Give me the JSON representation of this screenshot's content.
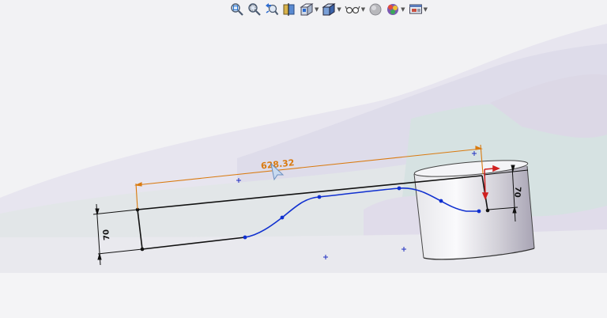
{
  "toolbar": {
    "items": [
      {
        "icon": "zoom-to-fit-icon",
        "has_dropdown": false
      },
      {
        "icon": "zoom-to-area-icon",
        "has_dropdown": false
      },
      {
        "icon": "previous-view-icon",
        "has_dropdown": false
      },
      {
        "icon": "section-view-icon",
        "has_dropdown": false
      },
      {
        "icon": "view-orientation-icon",
        "has_dropdown": true
      },
      {
        "icon": "display-style-icon",
        "has_dropdown": true
      },
      {
        "icon": "hide-show-items-icon",
        "has_dropdown": true
      },
      {
        "icon": "edit-appearance-icon",
        "has_dropdown": false
      },
      {
        "icon": "apply-scene-icon",
        "has_dropdown": true
      },
      {
        "icon": "view-settings-icon",
        "has_dropdown": true
      }
    ]
  },
  "sketch": {
    "linear_dimension": "628.32",
    "left_height_dimension": "70",
    "right_height_dimension": "70"
  },
  "colors": {
    "dimension": "#d97a10",
    "spline": "#1030d0",
    "sketch_line": "#111111",
    "relation_marker": "#2030c0",
    "origin_arrow": "#d02020"
  }
}
